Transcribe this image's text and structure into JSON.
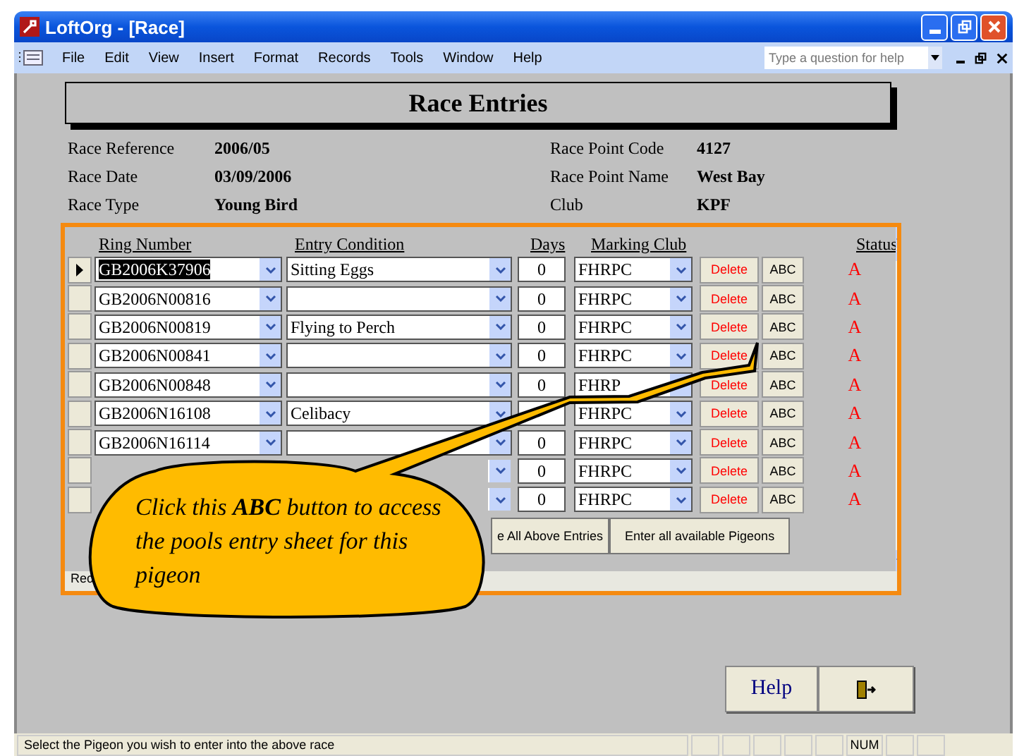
{
  "window": {
    "title": "LoftOrg - [Race]"
  },
  "menu": [
    "File",
    "Edit",
    "View",
    "Insert",
    "Format",
    "Records",
    "Tools",
    "Window",
    "Help"
  ],
  "help_search": {
    "placeholder": "Type a question for help"
  },
  "form": {
    "title": "Race Entries",
    "fields_left": [
      {
        "label": "Race Reference",
        "value": "2006/05"
      },
      {
        "label": "Race Date",
        "value": "03/09/2006"
      },
      {
        "label": "Race Type",
        "value": "Young Bird"
      }
    ],
    "fields_right": [
      {
        "label": "Race Point Code",
        "value": "4127"
      },
      {
        "label": "Race Point Name",
        "value": "West Bay"
      },
      {
        "label": "Club",
        "value": "KPF"
      }
    ]
  },
  "entries": {
    "columns": [
      "Ring Number",
      "Entry Condition",
      "Days",
      "Marking Club",
      "Status"
    ],
    "rows": [
      {
        "current": true,
        "ring_number": "GB2006K37906",
        "entry_condition": "Sitting Eggs",
        "days": "0",
        "marking_club": "FHRPC",
        "delete": "Delete",
        "abc": "ABC",
        "status": "A"
      },
      {
        "current": false,
        "ring_number": "GB2006N00816",
        "days": "0",
        "marking_club": "FHRPC",
        "delete": "Delete",
        "abc": "ABC",
        "status": "A"
      },
      {
        "current": false,
        "ring_number": "GB2006N00819",
        "entry_condition": "Flying to Perch",
        "days": "0",
        "marking_club": "FHRPC",
        "delete": "Delete",
        "abc": "ABC",
        "status": "A"
      },
      {
        "current": false,
        "ring_number": "GB2006N00841",
        "days": "0",
        "marking_club": "FHRPC",
        "delete": "Delete",
        "abc": "ABC",
        "status": "A"
      },
      {
        "current": false,
        "ring_number": "GB2006N00848",
        "days": "0",
        "marking_club": "FHRP",
        "delete": "Delete",
        "abc": "ABC",
        "status": "A"
      },
      {
        "current": false,
        "ring_number": "GB2006N16108",
        "entry_condition": "Celibacy",
        "marking_club": "FHRPC",
        "delete": "Delete",
        "abc": "ABC",
        "status": "A"
      },
      {
        "current": false,
        "ring_number": "GB2006N16114",
        "days": "0",
        "marking_club": "FHRPC",
        "delete": "Delete",
        "abc": "ABC",
        "status": "A"
      },
      {
        "current": false,
        "days": "0",
        "marking_club": "FHRPC",
        "delete": "Delete",
        "abc": "ABC",
        "status": "A"
      },
      {
        "current": false,
        "days": "0",
        "marking_club": "FHRPC",
        "delete": "Delete",
        "abc": "ABC",
        "status": "A"
      }
    ],
    "buttons": [
      "e All Above Entries",
      "Enter all available Pigeons"
    ],
    "record_label": "Rec"
  },
  "callout": "Click this **ABC** button to access the pools entry sheet for this pigeon",
  "help_button": "Help",
  "status_bar": {
    "message": "Select the Pigeon you wish to enter into the above race",
    "panels": [
      "NUM"
    ]
  }
}
